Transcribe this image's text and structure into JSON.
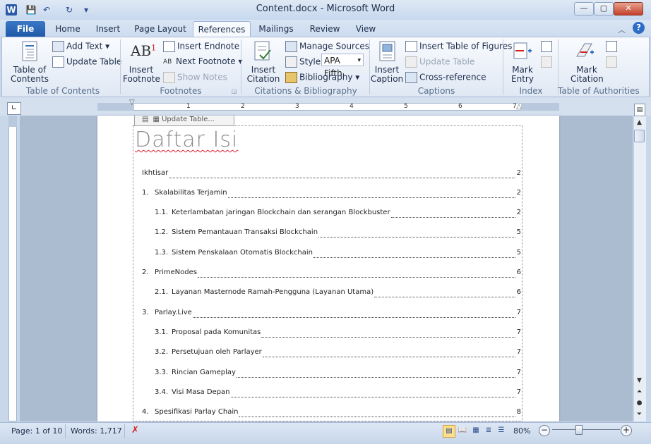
{
  "window": {
    "title": "Content.docx - Microsoft Word",
    "controls": {
      "minimize": "—",
      "maximize": "▢",
      "close": "✕"
    }
  },
  "tabs": [
    "File",
    "Home",
    "Insert",
    "Page Layout",
    "References",
    "Mailings",
    "Review",
    "View"
  ],
  "active_tab": "References",
  "ribbon": {
    "toc": {
      "table_of_contents": "Table of Contents",
      "add_text": "Add Text",
      "update_table": "Update Table",
      "group": "Table of Contents"
    },
    "footnotes": {
      "insert_footnote": "Insert Footnote",
      "insert_endnote": "Insert Endnote",
      "next_footnote": "Next Footnote",
      "show_notes": "Show Notes",
      "group": "Footnotes"
    },
    "citations": {
      "insert_citation": "Insert Citation",
      "manage_sources": "Manage Sources",
      "style_label": "Style:",
      "style_value": "APA Fifth",
      "bibliography": "Bibliography",
      "group": "Citations & Bibliography"
    },
    "captions": {
      "insert_caption": "Insert Caption",
      "insert_table_of_figures": "Insert Table of Figures",
      "update_table": "Update Table",
      "cross_reference": "Cross-reference",
      "group": "Captions"
    },
    "index": {
      "mark_entry": "Mark Entry",
      "group": "Index"
    },
    "toa": {
      "mark_citation": "Mark Citation",
      "group": "Table of Authorities"
    }
  },
  "ruler": {
    "numbers": [
      "1",
      "1",
      "2",
      "3",
      "4",
      "5",
      "6",
      "7"
    ]
  },
  "document": {
    "cc_tab_label": "Update Table...",
    "title": "Daftar Isi",
    "toc_entries": [
      {
        "num": "",
        "text": "Ikhtisar",
        "page": "2"
      },
      {
        "num": "1.",
        "text": "Skalabilitas Terjamin",
        "page": "2"
      },
      {
        "num": "1.1.",
        "text": "Keterlambatan jaringan Blockchain dan serangan Blockbuster",
        "page": "2"
      },
      {
        "num": "1.2.",
        "text": "Sistem Pemantauan Transaksi Blockchain",
        "page": "5"
      },
      {
        "num": "1.3.",
        "text": "Sistem Penskalaan Otomatis Blockchain",
        "page": "5"
      },
      {
        "num": "2.",
        "text": "PrimeNodes",
        "page": "6"
      },
      {
        "num": "2.1.",
        "text": "Layanan Masternode Ramah-Pengguna (Layanan Utama)",
        "page": "6"
      },
      {
        "num": "3.",
        "text": "Parlay.Live",
        "page": "7"
      },
      {
        "num": "3.1.",
        "text": "Proposal pada Komunitas",
        "page": "7"
      },
      {
        "num": "3.2.",
        "text": "Persetujuan oleh Parlayer",
        "page": "7"
      },
      {
        "num": "3.3.",
        "text": "Rincian Gameplay",
        "page": "7"
      },
      {
        "num": "3.4.",
        "text": "Visi Masa Depan",
        "page": "7"
      },
      {
        "num": "4.",
        "text": "Spesifikasi Parlay Chain",
        "page": "8"
      }
    ]
  },
  "status": {
    "page": "Page: 1 of 10",
    "words": "Words: 1,717",
    "zoom": "80%"
  },
  "icons": [
    "word-logo-icon",
    "save-icon",
    "undo-icon",
    "redo-icon",
    "customize-qat-icon",
    "help-icon",
    "ribbon-minimize-icon"
  ]
}
